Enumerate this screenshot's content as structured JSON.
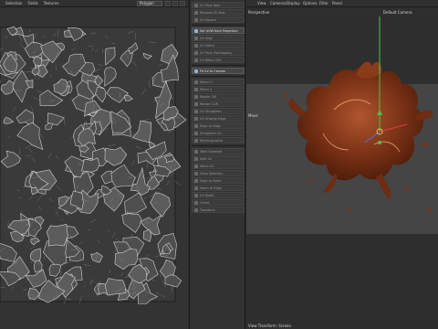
{
  "uv_editor": {
    "menu": [
      "Selection",
      "Fields",
      "Textures"
    ],
    "projection_select": "Polygon"
  },
  "command_panel": {
    "items": [
      {
        "label": "UV Pack Item"
      },
      {
        "label": "Relaxed UV Map"
      },
      {
        "label": "UV Square"
      },
      {
        "label": "Set UVW from Projection",
        "highlight": true
      },
      {
        "label": "UV Align"
      },
      {
        "label": "UV Match"
      },
      {
        "label": "UV Pack Overlapping"
      },
      {
        "label": "UV Relax Grid"
      },
      {
        "label": "Fit UV to Canvas",
        "highlight": true
      },
      {
        "label": "Mirror U"
      },
      {
        "label": "Mirror V"
      },
      {
        "label": "Rotate CW"
      },
      {
        "label": "Rotate CCW"
      },
      {
        "label": "UV Straighten"
      },
      {
        "label": "UV Unwrap Edge"
      },
      {
        "label": "Align to Edge"
      },
      {
        "label": "Straighten UV"
      },
      {
        "label": "Rectangularize"
      },
      {
        "label": "Weld Selected"
      },
      {
        "label": "Split UV"
      },
      {
        "label": "Stitch UV"
      },
      {
        "label": "Grow Selection"
      },
      {
        "label": "Edge to Seam"
      },
      {
        "label": "Seam to Edge"
      },
      {
        "label": "UV Reset"
      },
      {
        "label": "Orient"
      },
      {
        "label": "Transform"
      }
    ]
  },
  "viewport": {
    "menu": [
      "View",
      "Cameras",
      "Display",
      "Options",
      "Filter",
      "Panel"
    ],
    "view_name": "Perspective",
    "camera_name": "Default Camera",
    "side_label": "Move",
    "status": "View Transform: Screen"
  }
}
